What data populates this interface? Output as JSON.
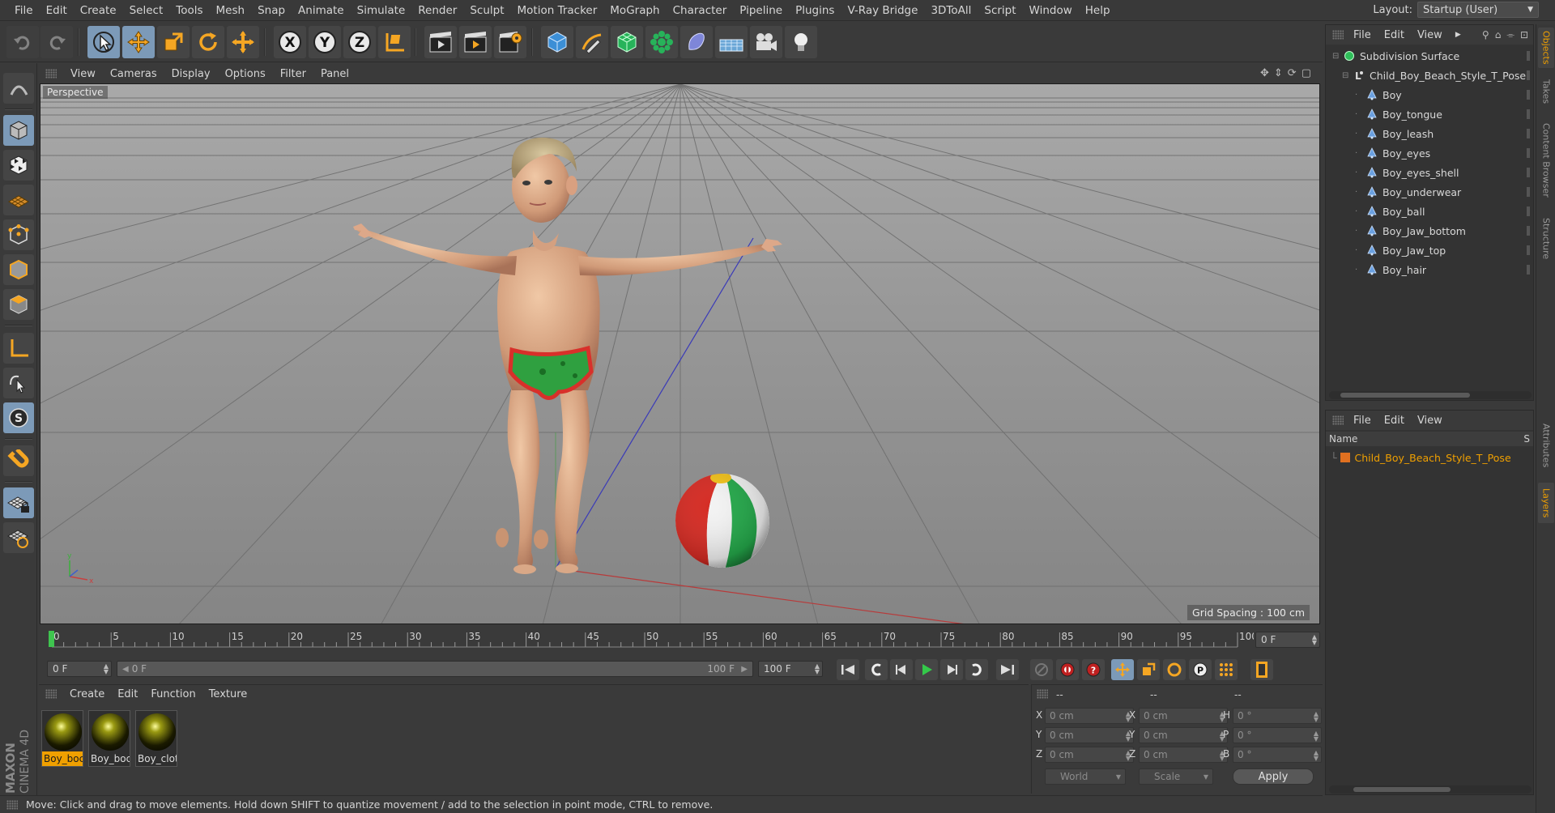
{
  "menubar": {
    "items": [
      "File",
      "Edit",
      "Create",
      "Select",
      "Tools",
      "Mesh",
      "Snap",
      "Animate",
      "Simulate",
      "Render",
      "Sculpt",
      "Motion Tracker",
      "MoGraph",
      "Character",
      "Pipeline",
      "Plugins",
      "V-Ray Bridge",
      "3DToAll",
      "Script",
      "Window",
      "Help"
    ],
    "layout_label": "Layout:",
    "layout_value": "Startup (User)"
  },
  "toolbar": {
    "icons": [
      "undo-icon",
      "redo-icon",
      "live-selection-icon",
      "move-icon",
      "scale-icon",
      "rotate-icon",
      "add-icon",
      "x-axis-icon",
      "y-axis-icon",
      "z-axis-icon",
      "coordinate-system-icon",
      "render-view-icon",
      "render-picture-viewer-icon",
      "render-settings-icon",
      "cube-icon",
      "pen-icon",
      "subdivision-surface-icon",
      "cloner-icon",
      "deformer-icon",
      "floor-icon",
      "camera-icon",
      "light-icon"
    ],
    "axis_letters": [
      "X",
      "Y",
      "Z"
    ]
  },
  "left_tools": {
    "icons": [
      "make-editable-icon",
      "model-mode-icon",
      "texture-mode-icon",
      "workplane-mode-icon",
      "points-mode-icon",
      "edges-mode-icon",
      "polygons-mode-icon",
      "enable-axis-icon",
      "tweak-icon",
      "snap-icon",
      "magnet-icon",
      "locked-workplane-icon",
      "planar-workplane-icon"
    ],
    "snap_letter": "S"
  },
  "brand": {
    "line1": "MAXON",
    "line2": "CINEMA 4D"
  },
  "viewport": {
    "menu": [
      "View",
      "Cameras",
      "Display",
      "Options",
      "Filter",
      "Panel"
    ],
    "label": "Perspective",
    "grid_spacing": "Grid Spacing : 100 cm"
  },
  "timeline": {
    "ticks": [
      "0",
      "5",
      "10",
      "15",
      "20",
      "25",
      "30",
      "35",
      "40",
      "45",
      "50",
      "55",
      "60",
      "65",
      "70",
      "75",
      "80",
      "85",
      "90",
      "95",
      "100"
    ],
    "current_frame": "0 F"
  },
  "transport": {
    "start_field": "0 F",
    "slider_start": "0 F",
    "slider_end": "100 F",
    "end_field": "100 F"
  },
  "materials": {
    "menu": [
      "Create",
      "Edit",
      "Function",
      "Texture"
    ],
    "items": [
      {
        "name": "Boy_boc",
        "selected": true
      },
      {
        "name": "Boy_boc",
        "selected": false
      },
      {
        "name": "Boy_clot",
        "selected": false
      }
    ]
  },
  "coordinates": {
    "header_left": "--",
    "header_mid": "--",
    "header_right": "--",
    "rows": [
      {
        "pos_label": "X",
        "pos": "0 cm",
        "size_label": "X",
        "size": "0 cm",
        "rot_label": "H",
        "rot": "0 °"
      },
      {
        "pos_label": "Y",
        "pos": "0 cm",
        "size_label": "Y",
        "size": "0 cm",
        "rot_label": "P",
        "rot": "0 °"
      },
      {
        "pos_label": "Z",
        "pos": "0 cm",
        "size_label": "Z",
        "size": "0 cm",
        "rot_label": "B",
        "rot": "0 °"
      }
    ],
    "world": "World",
    "scale": "Scale",
    "apply": "Apply"
  },
  "objects": {
    "menu": [
      "File",
      "Edit",
      "View"
    ],
    "tree": [
      {
        "name": "Subdivision Surface",
        "kind": "subdiv"
      },
      {
        "name": "Child_Boy_Beach_Style_T_Pose",
        "kind": "null"
      },
      {
        "name": "Boy",
        "kind": "joint"
      },
      {
        "name": "Boy_tongue",
        "kind": "joint"
      },
      {
        "name": "Boy_leash",
        "kind": "joint"
      },
      {
        "name": "Boy_eyes",
        "kind": "joint"
      },
      {
        "name": "Boy_eyes_shell",
        "kind": "joint"
      },
      {
        "name": "Boy_underwear",
        "kind": "joint"
      },
      {
        "name": "Boy_ball",
        "kind": "joint"
      },
      {
        "name": "Boy_Jaw_bottom",
        "kind": "joint"
      },
      {
        "name": "Boy_Jaw_top",
        "kind": "joint"
      },
      {
        "name": "Boy_hair",
        "kind": "joint"
      }
    ]
  },
  "layers": {
    "menu": [
      "File",
      "Edit",
      "View"
    ],
    "col_name": "Name",
    "col_s": "S",
    "items": [
      "Child_Boy_Beach_Style_T_Pose"
    ],
    "layer_color": "#e07020"
  },
  "side_tabs": [
    "Objects",
    "Takes",
    "Content Browser",
    "Structure",
    "Attributes",
    "Layers"
  ],
  "status": "Move: Click and drag to move elements. Hold down SHIFT to quantize movement / add to the selection in point mode, CTRL to remove.",
  "colors": {
    "accent": "#f0a000",
    "selected_tool": "#7c9ab8",
    "background": "#3a3a3a"
  }
}
